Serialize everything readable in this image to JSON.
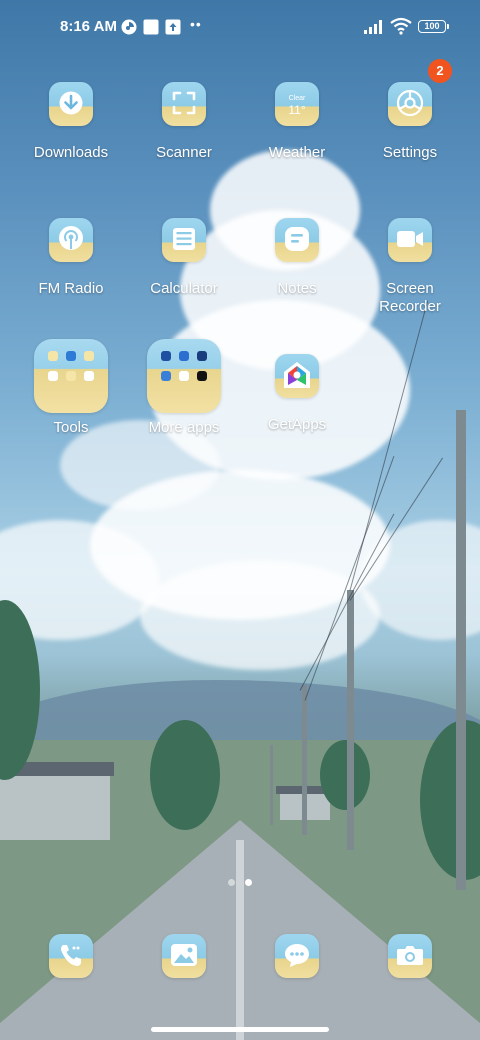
{
  "status_bar": {
    "time": "8:16 AM",
    "battery": "100",
    "icons": [
      "browser-icon",
      "square-notification-icon",
      "upload-icon",
      "more-dots-icon",
      "signal-icon",
      "wifi-icon",
      "battery-icon"
    ]
  },
  "apps": {
    "downloads": "Downloads",
    "scanner": "Scanner",
    "weather": "Weather",
    "weather_condition": "Clear",
    "weather_temp": "11°",
    "settings": "Settings",
    "settings_badge": "2",
    "fm_radio": "FM Radio",
    "calculator": "Calculator",
    "notes": "Notes",
    "screen_recorder": "Screen\nRecorder",
    "tools": "Tools",
    "more_apps": "More apps",
    "getapps": "GetApps"
  },
  "dock": {
    "items": [
      "phone-icon",
      "gallery-icon",
      "messages-icon",
      "camera-icon"
    ]
  },
  "pages": {
    "count": 2,
    "current": 2
  },
  "colors": {
    "badge": "#f1541e",
    "icon_sky": "#9fd6ef",
    "icon_sand": "#f1dfa0"
  }
}
